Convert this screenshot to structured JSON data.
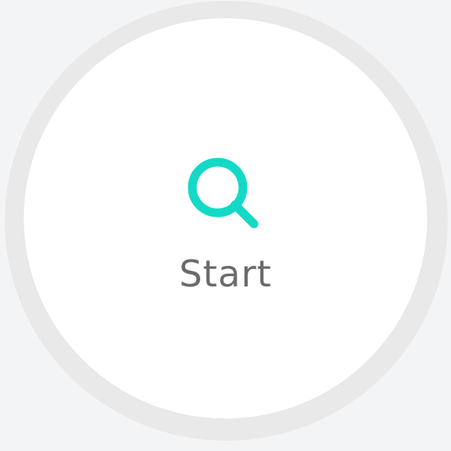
{
  "start": {
    "label": "Start",
    "icon": "search-icon",
    "icon_color": "#14d9c6",
    "text_color": "#6b6b6b"
  },
  "colors": {
    "background": "#f3f4f6",
    "ring": "#e8e8e8",
    "button_face": "#ffffff"
  }
}
